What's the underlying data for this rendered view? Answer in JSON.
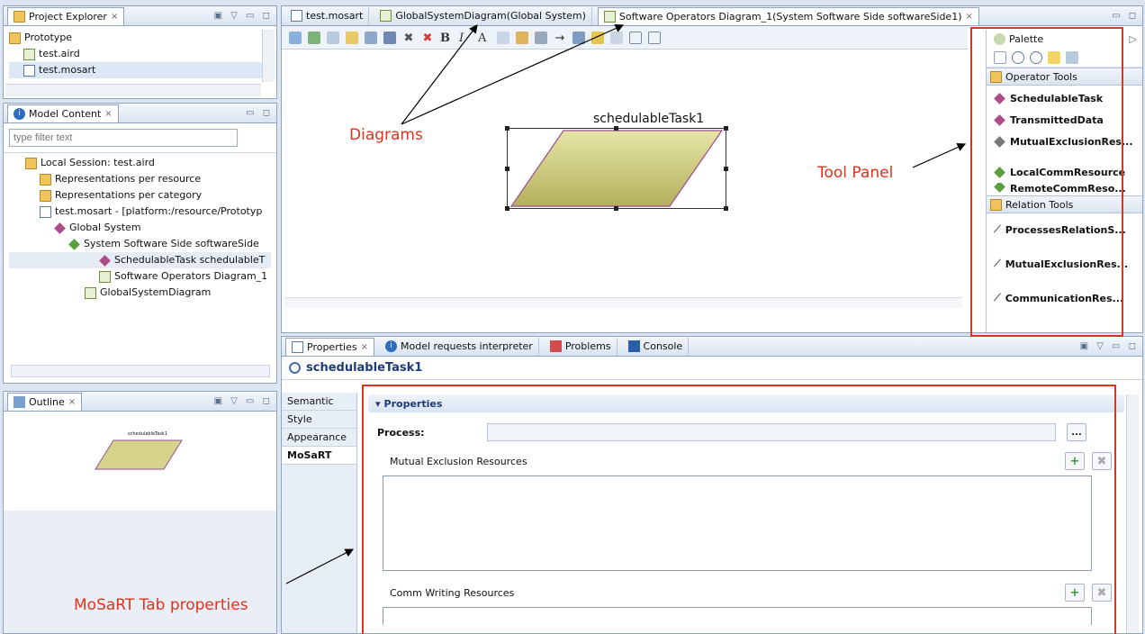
{
  "project_explorer": {
    "tab_label": "Project Explorer",
    "close_icon": "×",
    "items": [
      {
        "label": "Prototype",
        "icon": "folder-icon"
      },
      {
        "label": "test.aird",
        "icon": "aird-file-icon"
      },
      {
        "label": "test.mosart",
        "icon": "mosart-file-icon"
      }
    ]
  },
  "model_content": {
    "tab_label": "Model Content",
    "filter_placeholder": "type filter text",
    "tree": [
      {
        "label": "Local Session: test.aird",
        "icon": "folder-icon",
        "indent": 0
      },
      {
        "label": "Representations per resource",
        "icon": "folder-icon",
        "indent": 1
      },
      {
        "label": "Representations per category",
        "icon": "folder-icon",
        "indent": 1
      },
      {
        "label": "test.mosart - [platform:/resource/Prototyp",
        "icon": "file-icon",
        "indent": 1
      },
      {
        "label": "Global System",
        "icon": "diamond-icon",
        "indent": 2
      },
      {
        "label": "System Software Side softwareSide",
        "icon": "diamond-green-icon",
        "indent": 3
      },
      {
        "label": "SchedulableTask schedulableT",
        "icon": "diamond-icon",
        "indent": 4
      },
      {
        "label": "Software Operators Diagram_1",
        "icon": "diagram-icon",
        "indent": 4
      },
      {
        "label": "GlobalSystemDiagram",
        "icon": "diagram-icon",
        "indent": 3
      }
    ]
  },
  "outline": {
    "tab_label": "Outline",
    "thumb_label": "schedulableTask1"
  },
  "editor_tabs": [
    {
      "label": "test.mosart",
      "active": false
    },
    {
      "label": "GlobalSystemDiagram(Global System)",
      "active": false
    },
    {
      "label": "Software Operators Diagram_1(System Software Side softwareSide1)",
      "active": true
    }
  ],
  "diagram": {
    "node_label": "schedulableTask1",
    "node_fill": "#d5d48a",
    "node_border": "#9b4f8c"
  },
  "palette": {
    "title": "Palette",
    "operator_tools_label": "Operator Tools",
    "operator_tools": [
      "SchedulableTask",
      "TransmittedData",
      "MutualExclusionRes...",
      "LocalCommResource",
      "RemoteCommReso..."
    ],
    "relation_tools_label": "Relation Tools",
    "relation_tools": [
      "ProcessesRelationS...",
      "MutualExclusionRes...",
      "CommunicationRes..."
    ]
  },
  "bottom_tabs": [
    {
      "label": "Properties",
      "icon": "properties-icon",
      "active": true
    },
    {
      "label": "Model requests interpreter",
      "icon": "info-icon",
      "active": false
    },
    {
      "label": "Problems",
      "icon": "problems-icon",
      "active": false
    },
    {
      "label": "Console",
      "icon": "console-icon",
      "active": false
    }
  ],
  "properties": {
    "title": "schedulableTask1",
    "side_tabs": [
      {
        "label": "Semantic",
        "active": false
      },
      {
        "label": "Style",
        "active": false
      },
      {
        "label": "Appearance",
        "active": false
      },
      {
        "label": "MoSaRT",
        "active": true
      }
    ],
    "section_label": "Properties",
    "process_label": "Process:",
    "process_value": "",
    "browse_label": "...",
    "mutual_exclusion_label": "Mutual Exclusion Resources",
    "comm_writing_label": "Comm Writing Resources"
  },
  "annotations": {
    "diagrams": "Diagrams",
    "tool_panel": "Tool Panel",
    "mosart_tab": "MoSaRT Tab properties"
  },
  "colors": {
    "annotation_red": "#e0321c",
    "selection_blue": "#2d6cc0"
  }
}
